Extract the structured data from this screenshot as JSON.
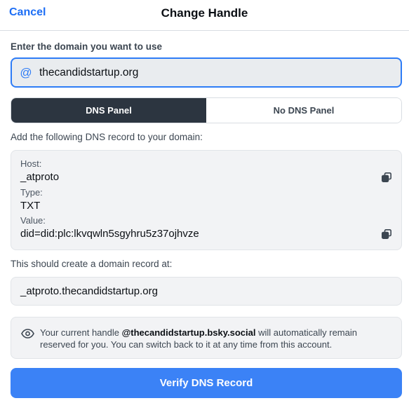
{
  "header": {
    "cancel_label": "Cancel",
    "title": "Change Handle"
  },
  "domain": {
    "label": "Enter the domain you want to use",
    "value": "thecandidstartup.org",
    "icon": "at-icon"
  },
  "tabs": [
    {
      "label": "DNS Panel",
      "active": true
    },
    {
      "label": "No DNS Panel",
      "active": false
    }
  ],
  "instructions": "Add the following DNS record to your domain:",
  "record": {
    "host_label": "Host:",
    "host_value": "_atproto",
    "type_label": "Type:",
    "type_value": "TXT",
    "value_label": "Value:",
    "value_value": "did=did:plc:lkvqwln5sgyhru5z37ojhvze",
    "copy_icon": "copy-icon"
  },
  "result": {
    "label": "This should create a domain record at:",
    "value": "_atproto.thecandidstartup.org"
  },
  "info": {
    "prefix": "Your current handle ",
    "handle": "@thecandidstartup.bsky.social",
    "suffix": " will automatically remain reserved for you. You can switch back to it at any time from this account.",
    "icon": "eye-icon"
  },
  "verify_label": "Verify DNS Record",
  "colors": {
    "accent": "#1d6ef5",
    "button": "#3b82f6",
    "active_tab": "#2c3540"
  }
}
